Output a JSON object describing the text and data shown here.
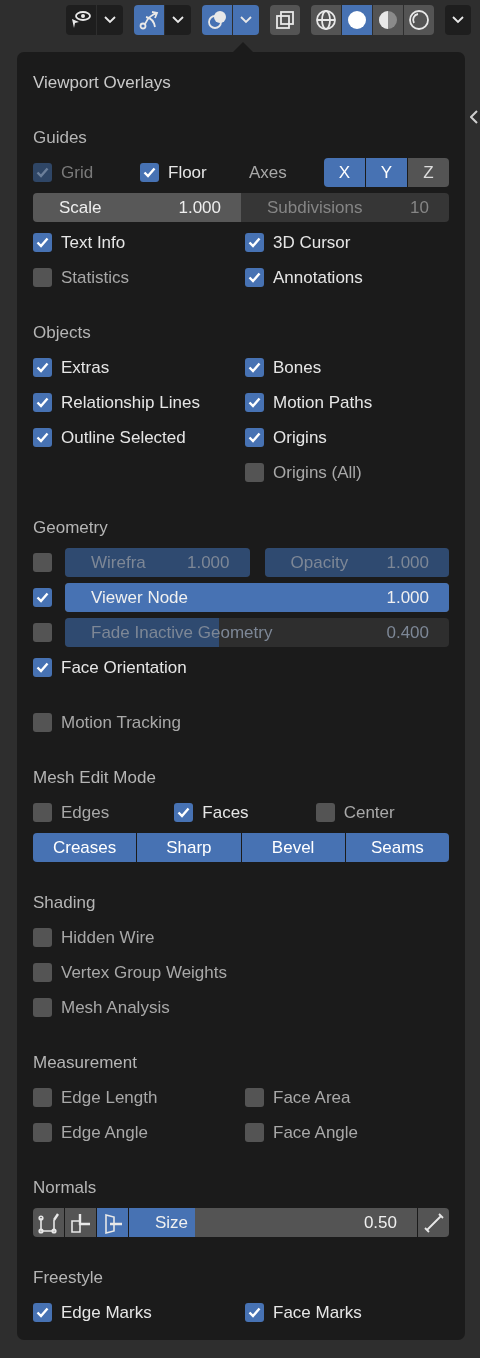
{
  "toolbar": {
    "groups": [
      {
        "buttons": [
          {
            "kind": "eye",
            "selected": false
          },
          {
            "kind": "caret",
            "selected": false
          }
        ]
      },
      {
        "buttons": [
          {
            "kind": "gizmo",
            "selected": true
          },
          {
            "kind": "caret",
            "selected": false
          }
        ]
      },
      {
        "buttons": [
          {
            "kind": "overlays",
            "selected": true
          },
          {
            "kind": "caret",
            "selected": true
          }
        ]
      },
      {
        "buttons": [
          {
            "kind": "xray",
            "selected": false
          }
        ]
      },
      {
        "buttons": [
          {
            "kind": "wireframe",
            "selected": false
          },
          {
            "kind": "solid",
            "selected": true
          },
          {
            "kind": "material",
            "selected": false
          },
          {
            "kind": "rendered",
            "selected": false
          }
        ]
      },
      {
        "buttons": [
          {
            "kind": "caret",
            "selected": false
          }
        ]
      }
    ]
  },
  "panel": {
    "title": "Viewport Overlays",
    "sections": [
      {
        "heading": "Guides",
        "rows": [
          {
            "kind": "guides",
            "items": [
              {
                "label": "Grid",
                "checked": true,
                "disabled": true
              },
              {
                "label": "Floor",
                "checked": true,
                "disabled": false
              }
            ],
            "axes_label": "Axes",
            "axes": [
              {
                "label": "X",
                "selected": true
              },
              {
                "label": "Y",
                "selected": true
              },
              {
                "label": "Z",
                "selected": false
              }
            ]
          },
          {
            "kind": "fields",
            "fields": [
              {
                "label": "Scale",
                "value": "1.000",
                "disabled": false
              },
              {
                "label": "Subdivisions",
                "value": "10",
                "disabled": true
              }
            ]
          },
          {
            "kind": "checks",
            "items": [
              {
                "label": "Text Info",
                "checked": true
              },
              {
                "label": "3D Cursor",
                "checked": true
              }
            ]
          },
          {
            "kind": "checks",
            "items": [
              {
                "label": "Statistics",
                "checked": false
              },
              {
                "label": "Annotations",
                "checked": true
              }
            ]
          }
        ]
      },
      {
        "heading": "Objects",
        "rows": [
          {
            "kind": "checks",
            "items": [
              {
                "label": "Extras",
                "checked": true
              },
              {
                "label": "Bones",
                "checked": true
              }
            ]
          },
          {
            "kind": "checks",
            "items": [
              {
                "label": "Relationship Lines",
                "checked": true
              },
              {
                "label": "Motion Paths",
                "checked": true
              }
            ]
          },
          {
            "kind": "checks",
            "items": [
              {
                "label": "Outline Selected",
                "checked": true
              },
              {
                "label": "Origins",
                "checked": true
              }
            ]
          },
          {
            "kind": "right-checks",
            "items": [
              {
                "label": "Origins (All)",
                "checked": false
              }
            ]
          }
        ]
      },
      {
        "heading": "Geometry",
        "rows": [
          {
            "kind": "check-sliders",
            "checked": false,
            "sliders": [
              {
                "label": "Wirefra",
                "value": "1.000",
                "level": 1,
                "disabled": true
              },
              {
                "label": "Opacity",
                "value": "1.000",
                "level": 1,
                "disabled": true
              }
            ]
          },
          {
            "kind": "check-sliders",
            "checked": true,
            "sliders": [
              {
                "label": "Viewer Node",
                "value": "1.000",
                "level": 1,
                "disabled": false
              }
            ]
          },
          {
            "kind": "check-sliders",
            "checked": false,
            "sliders": [
              {
                "label": "Fade Inactive Geometry",
                "value": "0.400",
                "level": 0.4,
                "disabled": true
              }
            ]
          },
          {
            "kind": "checks",
            "items": [
              {
                "label": "Face Orientation",
                "checked": true
              }
            ]
          }
        ]
      },
      {
        "rows": [
          {
            "kind": "checks",
            "items": [
              {
                "label": "Motion Tracking",
                "checked": false
              }
            ]
          }
        ]
      },
      {
        "heading": "Mesh Edit Mode",
        "rows": [
          {
            "kind": "checks",
            "items": [
              {
                "label": "Edges",
                "checked": false
              },
              {
                "label": "Faces",
                "checked": true
              },
              {
                "label": "Center",
                "checked": false
              }
            ]
          },
          {
            "kind": "toggles",
            "buttons": [
              {
                "label": "Creases",
                "selected": true
              },
              {
                "label": "Sharp",
                "selected": true
              },
              {
                "label": "Bevel",
                "selected": true
              },
              {
                "label": "Seams",
                "selected": true
              }
            ]
          }
        ]
      },
      {
        "heading": "Shading",
        "rows": [
          {
            "kind": "checks",
            "items": [
              {
                "label": "Hidden Wire",
                "checked": false
              }
            ]
          },
          {
            "kind": "checks",
            "items": [
              {
                "label": "Vertex Group Weights",
                "checked": false
              }
            ]
          },
          {
            "kind": "checks",
            "items": [
              {
                "label": "Mesh Analysis",
                "checked": false
              }
            ]
          }
        ]
      },
      {
        "heading": "Measurement",
        "rows": [
          {
            "kind": "checks",
            "items": [
              {
                "label": "Edge Length",
                "checked": false
              },
              {
                "label": "Face Area",
                "checked": false
              }
            ]
          },
          {
            "kind": "checks",
            "items": [
              {
                "label": "Edge Angle",
                "checked": false
              },
              {
                "label": "Face Angle",
                "checked": false
              }
            ]
          }
        ]
      },
      {
        "heading": "Normals",
        "rows": [
          {
            "kind": "normals",
            "buttons": [
              {
                "kind": "vertex",
                "selected": false
              },
              {
                "kind": "split",
                "selected": false
              },
              {
                "kind": "face",
                "selected": true
              }
            ],
            "slider": {
              "label": "Size",
              "value": "0.50",
              "level": 0.23
            }
          }
        ]
      },
      {
        "heading": "Freestyle",
        "rows": [
          {
            "kind": "checks",
            "items": [
              {
                "label": "Edge Marks",
                "checked": true
              },
              {
                "label": "Face Marks",
                "checked": true
              }
            ]
          }
        ]
      }
    ]
  }
}
